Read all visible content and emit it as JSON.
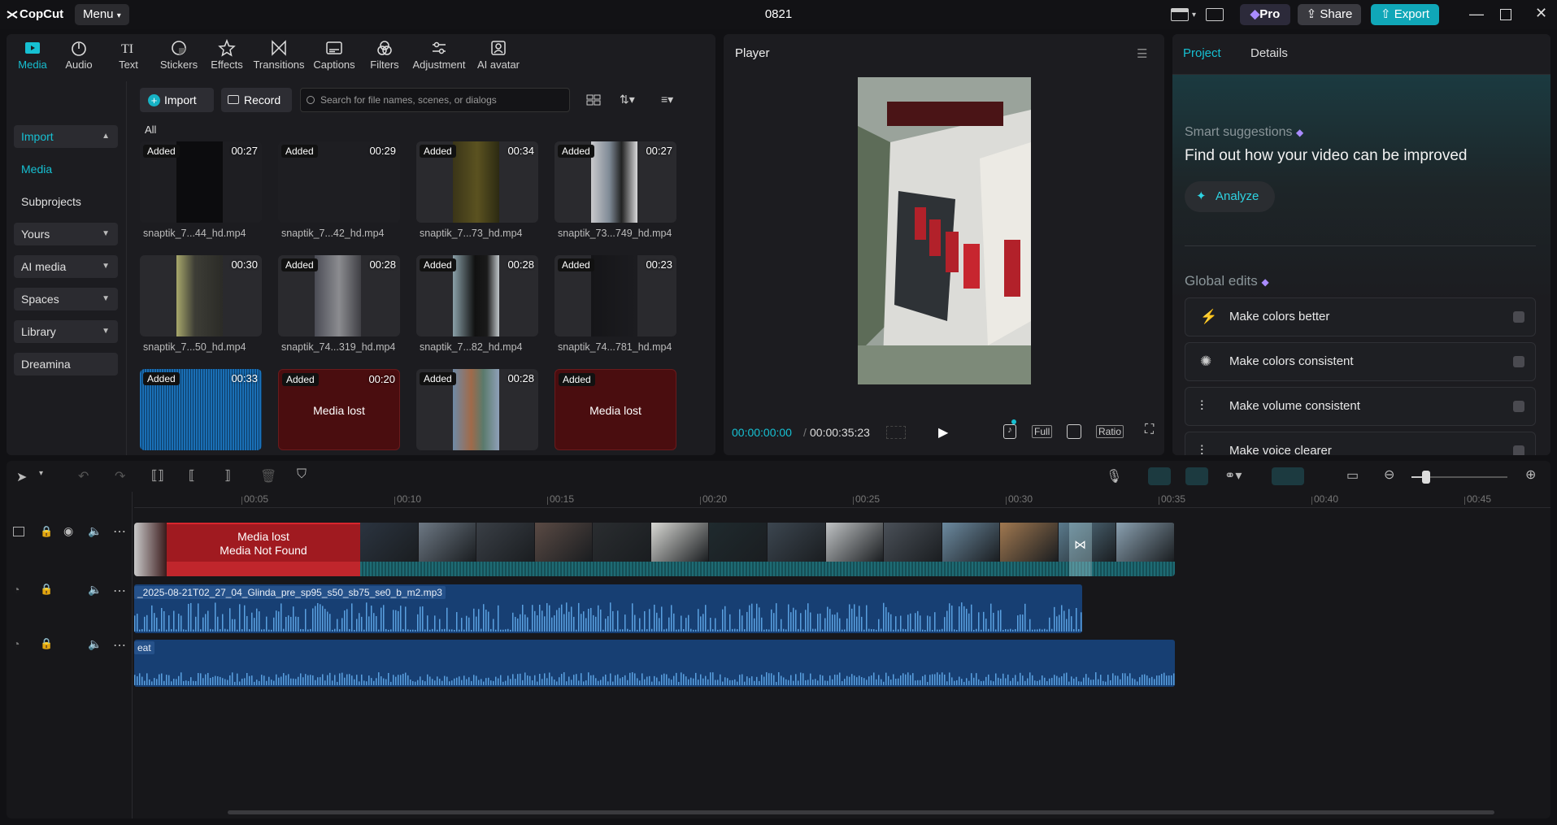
{
  "app": {
    "name": "CopCut",
    "menu_label": "Menu",
    "project_title": "0821"
  },
  "topbar": {
    "pro_label": "Pro",
    "share_label": "Share",
    "export_label": "Export"
  },
  "toolbar": {
    "tabs": [
      {
        "label": "Media",
        "icon": "media-icon",
        "active": true
      },
      {
        "label": "Audio",
        "icon": "audio-icon"
      },
      {
        "label": "Text",
        "icon": "text-icon"
      },
      {
        "label": "Stickers",
        "icon": "stickers-icon"
      },
      {
        "label": "Effects",
        "icon": "effects-icon"
      },
      {
        "label": "Transitions",
        "icon": "transitions-icon"
      },
      {
        "label": "Captions",
        "icon": "captions-icon"
      },
      {
        "label": "Filters",
        "icon": "filters-icon"
      },
      {
        "label": "Adjustment",
        "icon": "adjustment-icon"
      },
      {
        "label": "AI avatar",
        "icon": "ai-avatar-icon"
      }
    ]
  },
  "sidebar": {
    "items": [
      {
        "label": "Import",
        "active": true
      },
      {
        "label": "Media",
        "sub": true,
        "active": true
      },
      {
        "label": "Subprojects",
        "sub": true
      },
      {
        "label": "Yours"
      },
      {
        "label": "AI media"
      },
      {
        "label": "Spaces"
      },
      {
        "label": "Library"
      },
      {
        "label": "Dreamina"
      }
    ]
  },
  "media": {
    "import_label": "Import",
    "record_label": "Record",
    "search_placeholder": "Search for file names, scenes, or dialogs",
    "filter_label": "All",
    "items": [
      {
        "badge": "Added",
        "duration": "00:27",
        "name": "snaptik_7...44_hd.mp4",
        "thumb": "dark"
      },
      {
        "badge": "Added",
        "duration": "00:29",
        "name": "snaptik_7...42_hd.mp4",
        "thumb": "car"
      },
      {
        "badge": "Added",
        "duration": "00:34",
        "name": "snaptik_7...73_hd.mp4",
        "thumb": "olive"
      },
      {
        "badge": "Added",
        "duration": "00:27",
        "name": "snaptik_73...749_hd.mp4",
        "thumb": "car2"
      },
      {
        "badge": "",
        "duration": "00:30",
        "name": "snaptik_7...50_hd.mp4",
        "thumb": "blur"
      },
      {
        "badge": "Added",
        "duration": "00:28",
        "name": "snaptik_74...319_hd.mp4",
        "thumb": "interior"
      },
      {
        "badge": "Added",
        "duration": "00:28",
        "name": "snaptik_7...82_hd.mp4",
        "thumb": "car3"
      },
      {
        "badge": "Added",
        "duration": "00:23",
        "name": "snaptik_74...781_hd.mp4",
        "thumb": "night"
      },
      {
        "badge": "Added",
        "duration": "00:33",
        "name": "",
        "thumb": "audio"
      },
      {
        "badge": "Added",
        "duration": "00:20",
        "name": "",
        "thumb": "lost",
        "lost_label": "Media lost"
      },
      {
        "badge": "Added",
        "duration": "00:28",
        "name": "",
        "thumb": "street"
      },
      {
        "badge": "Added",
        "duration": "",
        "name": "",
        "thumb": "lost",
        "lost_label": "Media lost"
      }
    ]
  },
  "player": {
    "title": "Player",
    "current_time": "00:00:00:00",
    "total_time": "00:00:35:23",
    "full_label": "Full",
    "ratio_label": "Ratio"
  },
  "right_panel": {
    "tabs": [
      "Project",
      "Details"
    ],
    "smart_title": "Smart suggestions",
    "smart_headline": "Find out how your video can be improved",
    "analyze_label": "Analyze",
    "global_title": "Global edits",
    "global_items": [
      {
        "label": "Make colors better",
        "icon": "magic-wand-icon"
      },
      {
        "label": "Make colors consistent",
        "icon": "color-match-icon"
      },
      {
        "label": "Make volume consistent",
        "icon": "sliders-icon"
      },
      {
        "label": "Make voice clearer",
        "icon": "voice-icon"
      }
    ]
  },
  "timeline": {
    "ticks": [
      "00:05",
      "00:10",
      "00:15",
      "00:20",
      "00:25",
      "00:30",
      "00:35",
      "00:40",
      "00:45"
    ],
    "video_clip_lost_line1": "Media lost",
    "video_clip_lost_line2": "Media Not Found",
    "audio1_label": "_2025-08-21T02_27_04_Glinda_pre_sp95_s50_sb75_se0_b_m2.mp3",
    "audio2_label": "eat",
    "zoom_level": 0.15
  },
  "colors": {
    "accent": "#16c0d2",
    "export": "#10a7b8",
    "lost": "#4a0d0f",
    "audio": "#163f78"
  }
}
